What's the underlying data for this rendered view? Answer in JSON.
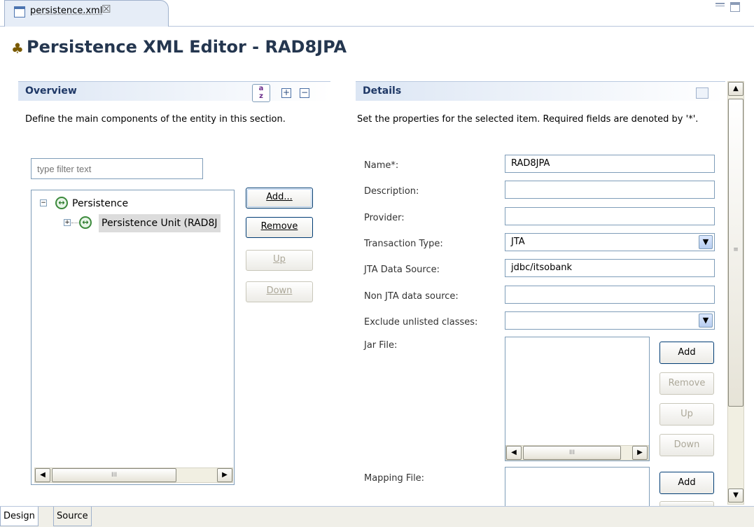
{
  "editor_tab": {
    "label": "persistence.xml",
    "close_glyph": "☒"
  },
  "form_title": "Persistence XML Editor - RAD8JPA",
  "overview": {
    "title": "Overview",
    "description": "Define the main components of the entity in this section.",
    "filter_placeholder": "type filter text",
    "tree": [
      {
        "label": "Persistence",
        "expanded": true
      },
      {
        "label": "Persistence Unit (RAD8J",
        "expanded": false,
        "selected": true
      }
    ],
    "buttons": {
      "add": "Add...",
      "remove": "Remove",
      "up": "Up",
      "down": "Down"
    },
    "toolbar_icons": [
      "sort-az-icon",
      "expand-all-icon",
      "collapse-all-icon"
    ]
  },
  "details": {
    "title": "Details",
    "description": "Set the properties for the selected item. Required fields are denoted by '*'.",
    "fields": {
      "name_label": "Name*:",
      "name_value": "RAD8JPA",
      "description_label": "Description:",
      "description_value": "",
      "provider_label": "Provider:",
      "provider_value": "",
      "transaction_label": "Transaction Type:",
      "transaction_value": "JTA",
      "jta_label": "JTA Data Source:",
      "jta_value": "jdbc/itsobank",
      "non_jta_label": "Non JTA data source:",
      "non_jta_value": "",
      "exclude_label": "Exclude unlisted classes:",
      "exclude_value": "",
      "jar_label": "Jar File:",
      "mapping_label": "Mapping File:"
    },
    "jar_buttons": {
      "add": "Add",
      "remove": "Remove",
      "up": "Up",
      "down": "Down"
    },
    "mapping_buttons": {
      "add": "Add"
    }
  },
  "bottom_tabs": [
    "Design",
    "Source"
  ],
  "scroll_thumb_glyph": "III",
  "colors": {
    "title": "#24364f",
    "section_title": "#1f3866",
    "accent_border": "#003c74"
  }
}
